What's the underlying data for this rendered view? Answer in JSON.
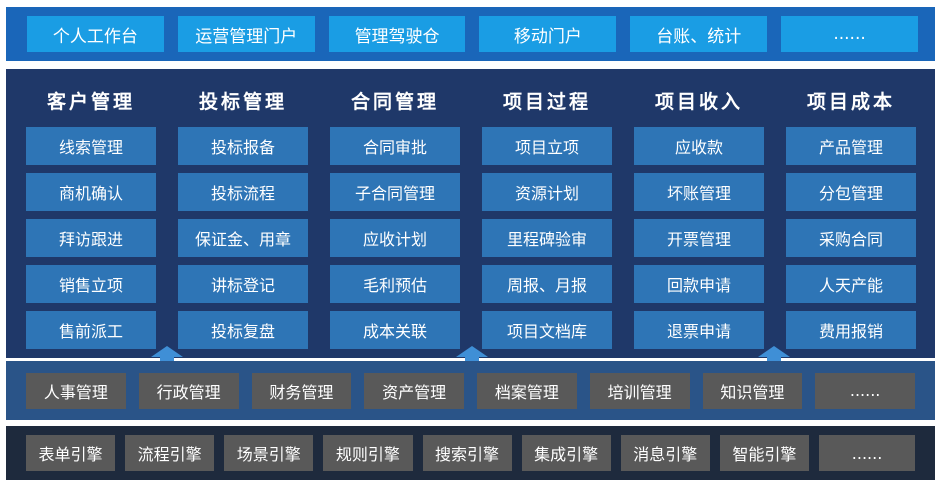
{
  "portal": {
    "items": [
      "个人工作台",
      "运营管理门户",
      "管理驾驶仓",
      "移动门户",
      "台账、统计",
      "......"
    ]
  },
  "modules": [
    {
      "title": "客户管理",
      "items": [
        "线索管理",
        "商机确认",
        "拜访跟进",
        "销售立项",
        "售前派工"
      ]
    },
    {
      "title": "投标管理",
      "items": [
        "投标报备",
        "投标流程",
        "保证金、用章",
        "讲标登记",
        "投标复盘"
      ]
    },
    {
      "title": "合同管理",
      "items": [
        "合同审批",
        "子合同管理",
        "应收计划",
        "毛利预估",
        "成本关联"
      ]
    },
    {
      "title": "项目过程",
      "items": [
        "项目立项",
        "资源计划",
        "里程碑验审",
        "周报、月报",
        "项目文档库"
      ]
    },
    {
      "title": "项目收入",
      "items": [
        "应收款",
        "坏账管理",
        "开票管理",
        "回款申请",
        "退票申请"
      ]
    },
    {
      "title": "项目成本",
      "items": [
        "产品管理",
        "分包管理",
        "采购合同",
        "人天产能",
        "费用报销"
      ]
    }
  ],
  "support": {
    "items": [
      "人事管理",
      "行政管理",
      "财务管理",
      "资产管理",
      "档案管理",
      "培训管理",
      "知识管理",
      "......"
    ]
  },
  "engines": {
    "items": [
      "表单引擎",
      "流程引擎",
      "场景引擎",
      "规则引擎",
      "搜索引擎",
      "集成引擎",
      "消息引擎",
      "智能引擎",
      "......"
    ]
  },
  "colors": {
    "portal_bg": "#1a66b9",
    "portal_btn": "#1a9de4",
    "main_bg": "#1f3869",
    "module_btn": "#2e75b6",
    "support_bg": "#2a5488",
    "engine_bg": "#1e2a3d",
    "gray_btn": "#595959",
    "arrow": "#3f8fd6"
  }
}
